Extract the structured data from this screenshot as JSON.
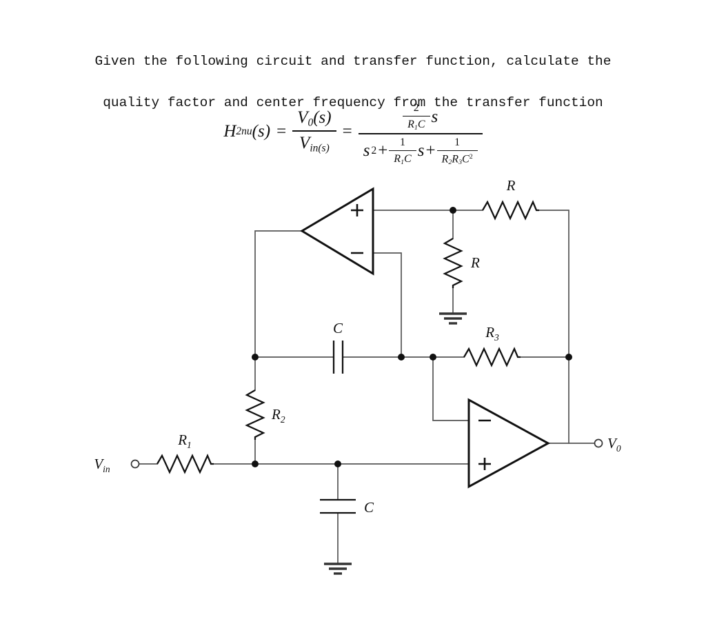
{
  "prompt": {
    "line1": "Given the following circuit and transfer function, calculate the",
    "line2": "quality factor and center frequency from the transfer function"
  },
  "equation": {
    "lhs_symbol": "H",
    "lhs_sub": "2nu",
    "lhs_arg": "(s)",
    "equals": "=",
    "ratio_num_symbol": "V",
    "ratio_num_sub": "0",
    "ratio_num_arg": "(s)",
    "ratio_den_symbol": "V",
    "ratio_den_sub": "in(s)",
    "equals2": "=",
    "rhs_num_frac_top": "2",
    "rhs_num_frac_bot_r": "R",
    "rhs_num_frac_bot_r_sub": "1",
    "rhs_num_frac_bot_c": "C",
    "rhs_num_tail": "s",
    "rhs_den_s2": "s",
    "rhs_den_s2_sup": "2",
    "rhs_den_plus1": "+",
    "rhs_den_f1_top": "1",
    "rhs_den_f1_bot_r": "R",
    "rhs_den_f1_bot_r_sub": "1",
    "rhs_den_f1_bot_c": "C",
    "rhs_den_f1_tail": "s",
    "rhs_den_plus2": "+",
    "rhs_den_f2_top": "1",
    "rhs_den_f2_bot_r2": "R",
    "rhs_den_f2_bot_r2_sub": "2",
    "rhs_den_f2_bot_r3": "R",
    "rhs_den_f2_bot_r3_sub": "3",
    "rhs_den_f2_bot_c": "C",
    "rhs_den_f2_bot_c_sup": "2"
  },
  "circuit": {
    "line_color": "#555555",
    "component_color": "#111111",
    "labels": {
      "vin": "V",
      "vin_sub": "in",
      "vout": "V",
      "vout_sub": "0",
      "r1": "R",
      "r1_sub": "1",
      "r2": "R",
      "r2_sub": "2",
      "r3": "R",
      "r3_sub": "3",
      "r_feedback_series": "R",
      "r_feedback_shunt": "R",
      "c_series": "C",
      "c_shunt": "C",
      "opamp1_plus": "+",
      "opamp1_minus": "−",
      "opamp2_plus": "+",
      "opamp2_minus": "−"
    }
  }
}
